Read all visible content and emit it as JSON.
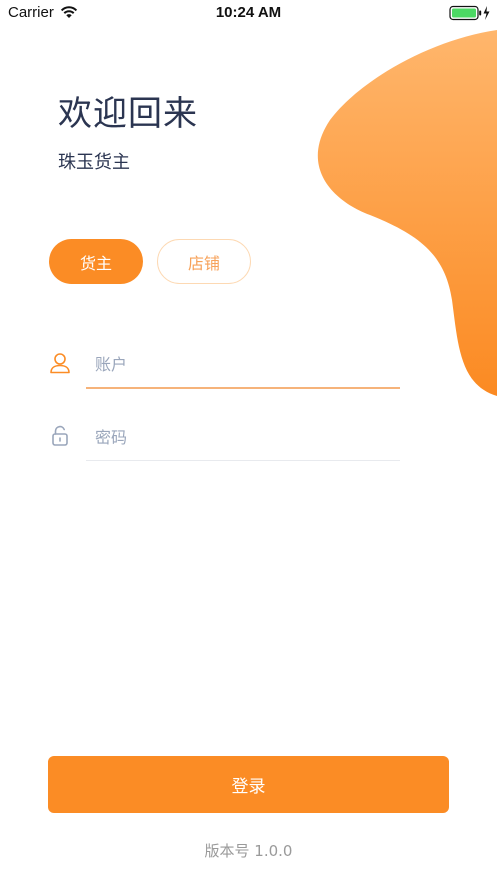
{
  "status_bar": {
    "carrier": "Carrier",
    "time": "10:24 AM",
    "wifi_icon": "wifi-icon",
    "battery_icon": "battery-charging-icon"
  },
  "header": {
    "title": "欢迎回来",
    "subtitle": "珠玉货主"
  },
  "roles": {
    "active_label": "货主",
    "inactive_label": "店铺"
  },
  "form": {
    "account_placeholder": "账户",
    "account_icon": "user-icon",
    "password_placeholder": "密码",
    "password_icon": "lock-icon"
  },
  "actions": {
    "login_label": "登录"
  },
  "footer": {
    "version": "版本号 1.0.0"
  },
  "colors": {
    "accent": "#fb8c25",
    "accent_light": "#ffb36a",
    "title_text": "#2b3551",
    "placeholder": "#9aa6bb"
  }
}
